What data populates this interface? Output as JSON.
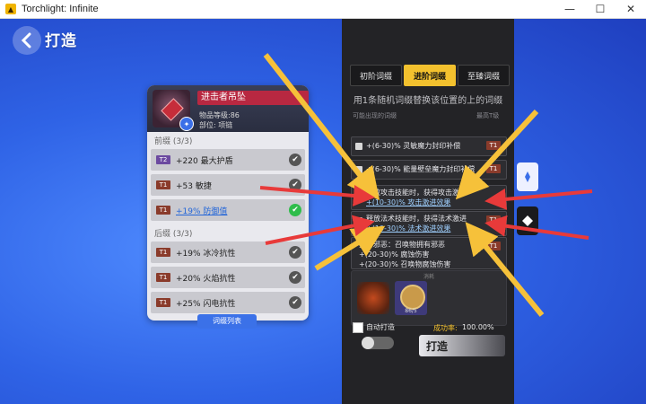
{
  "window": {
    "title": "Torchlight: Infinite",
    "minimize": "—",
    "maximize": "☐",
    "close": "✕"
  },
  "header": {
    "title": "打造",
    "back_icon": "chevron-left-icon"
  },
  "item": {
    "name": "进击者吊坠",
    "level_label": "物品等级:86",
    "slot_label": "部位: 项链",
    "prefix_label": "前缀 (3/3)",
    "prefixes": [
      {
        "tier": "T2",
        "text": "+220 最大护盾"
      },
      {
        "tier": "T1",
        "text": "+53 敏捷"
      },
      {
        "tier": "T1",
        "text": "+19% 防御值",
        "selected": true
      }
    ],
    "suffix_label": "后缀 (3/3)",
    "suffixes": [
      {
        "tier": "T1",
        "text": "+19% 冰冷抗性"
      },
      {
        "tier": "T1",
        "text": "+20% 火焰抗性"
      },
      {
        "tier": "T1",
        "text": "+25% 闪电抗性"
      }
    ],
    "list_button": "词缀列表"
  },
  "craft": {
    "tabs": [
      "初阶词缀",
      "进阶词缀",
      "至臻词缀"
    ],
    "active_tab": 1,
    "subtitle": "用1条随机词缀替换该位置的上的词缀",
    "col_possible": "可能出现的词缀",
    "col_tier": "最高T级",
    "options": [
      {
        "lines": [
          "+(6-30)% 灵敏魔力封印补偿"
        ],
        "tier": "T1"
      },
      {
        "lines": [
          "+(6-30)% 能量壁垒魔力封印补偿"
        ],
        "tier": "T1"
      },
      {
        "lines": [
          "释放攻击技能时，获得攻击激进",
          "+(10-30)% 攻击激进效果"
        ],
        "tier": "T1"
      },
      {
        "lines": [
          "释放法术技能时，获得法术激进",
          "+(10-30)% 法术激进效果"
        ],
        "tier": "T1"
      },
      {
        "lines": [
          "拥有邪恶：召唤物拥有邪恶",
          "+(20-30)% 腐蚀伤害",
          "+(20-30)% 召唤物腐蚀伤害"
        ],
        "tier": "T1"
      }
    ],
    "consume_label": "消耗",
    "material_count": "86/5",
    "auto_label": "自动打造",
    "success_label": "成功率:",
    "success_value": "100.00%",
    "forge_button": "打造"
  },
  "colors": {
    "accent": "#f3c12e",
    "item_name_bg": "#b82841",
    "arrow_red": "#e83a3a",
    "arrow_yellow": "#f6c13a"
  }
}
